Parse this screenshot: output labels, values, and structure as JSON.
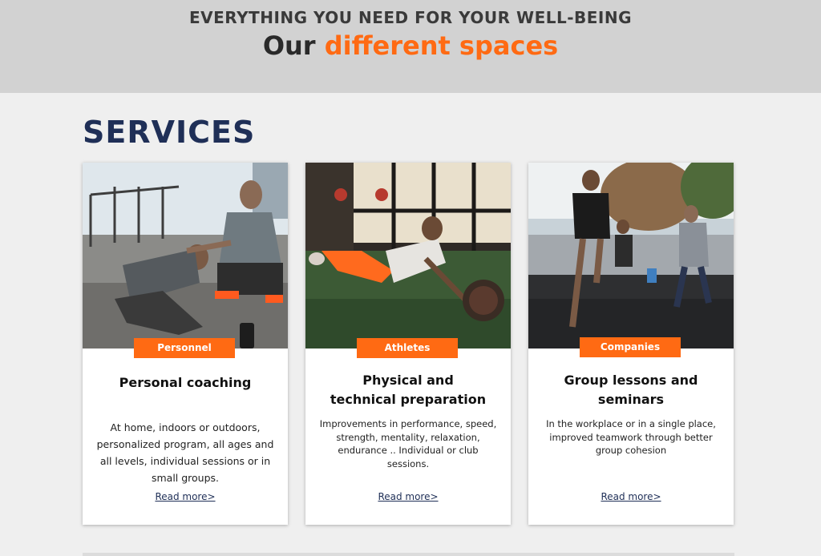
{
  "hero": {
    "eyebrow": "EVERYTHING YOU NEED FOR YOUR WELL-BEING",
    "title_lead": "Our",
    "title_accent": "different spaces"
  },
  "section": {
    "title": "SERVICES"
  },
  "cards": [
    {
      "tag": "Personnel",
      "heading": "Personal coaching",
      "description": "At home, indoors or outdoors, personalized program, all ages and all levels, individual sessions or in small groups.",
      "read_more": "Read more>"
    },
    {
      "tag": "Athletes",
      "heading": "Physical and technical preparation",
      "description": "Improvements in performance, speed, strength, mentality, relaxation, endurance .. Individual or club sessions.",
      "read_more": "Read more>"
    },
    {
      "tag": "Companies",
      "heading": "Group lessons and seminars",
      "description": "In the workplace or in a single place, improved teamwork through better group cohesion",
      "read_more": "Read more>"
    }
  ],
  "colors": {
    "accent": "#ff6a13",
    "navy": "#1f2f57",
    "hero_bg": "#d2d2d2",
    "page_bg": "#efefef"
  }
}
